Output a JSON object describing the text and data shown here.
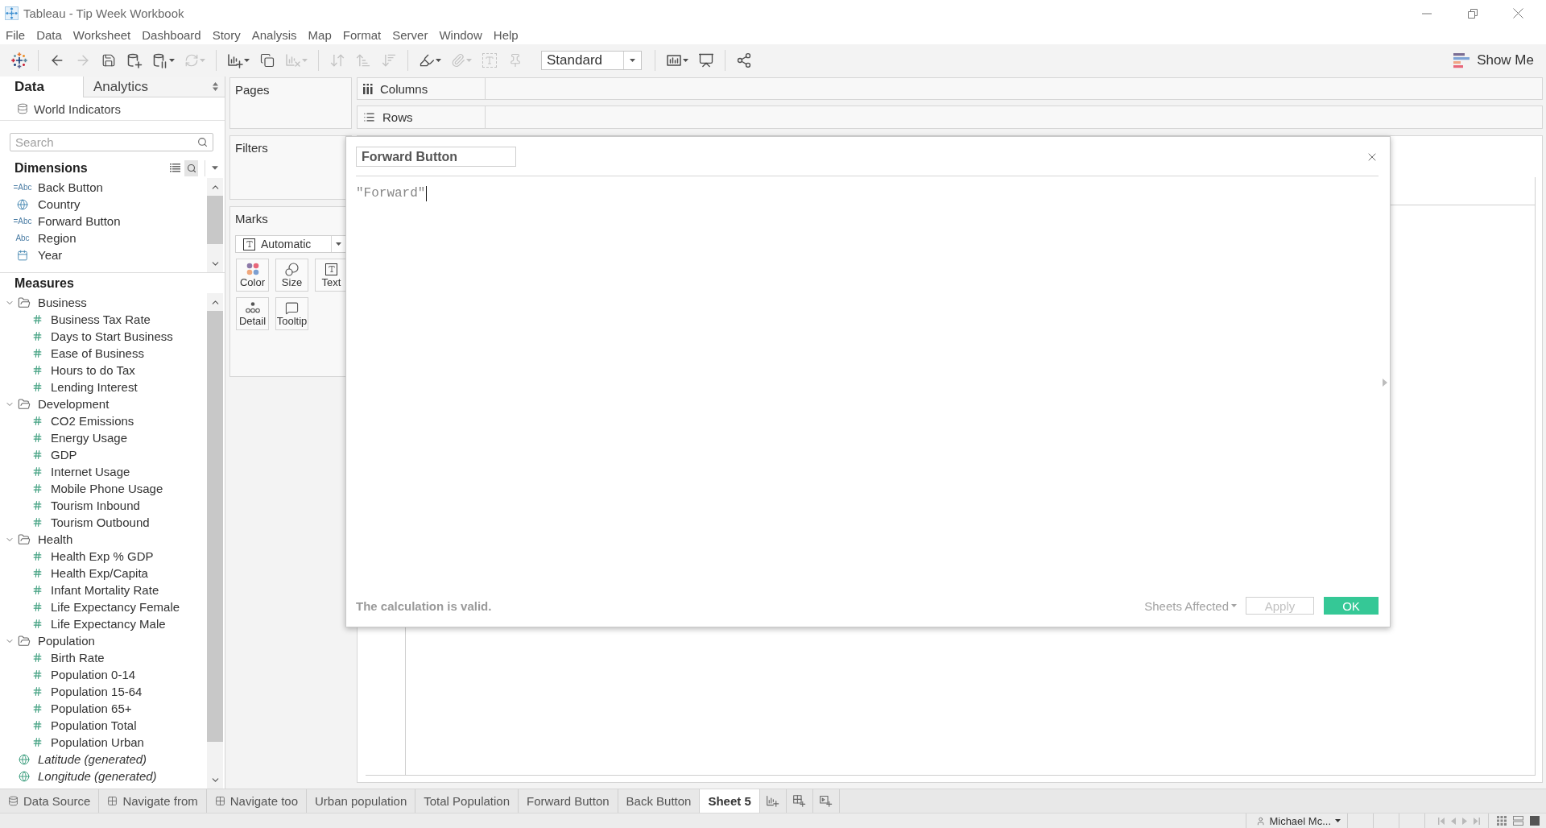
{
  "window": {
    "title": "Tableau - Tip Week Workbook"
  },
  "menu": [
    "File",
    "Data",
    "Worksheet",
    "Dashboard",
    "Story",
    "Analysis",
    "Map",
    "Format",
    "Server",
    "Window",
    "Help"
  ],
  "toolbar": {
    "groups": [
      [
        {
          "kind": "logo",
          "disabled": false,
          "menu": false
        }
      ],
      [
        {
          "kind": "back",
          "disabled": false,
          "menu": false
        },
        {
          "kind": "forward",
          "disabled": true,
          "menu": false
        },
        {
          "kind": "save",
          "disabled": false,
          "menu": false
        },
        {
          "kind": "new-data-source",
          "disabled": false,
          "menu": false
        },
        {
          "kind": "pause-updates",
          "disabled": false,
          "menu": true
        },
        {
          "kind": "refresh",
          "disabled": true,
          "menu": true
        }
      ],
      [
        {
          "kind": "new-worksheet",
          "disabled": false,
          "menu": true
        },
        {
          "kind": "duplicate",
          "disabled": false,
          "menu": false
        },
        {
          "kind": "clear",
          "disabled": true,
          "menu": true
        }
      ],
      [
        {
          "kind": "swap",
          "disabled": true,
          "menu": false
        },
        {
          "kind": "sort-ascending",
          "disabled": true,
          "menu": false
        },
        {
          "kind": "sort-descending",
          "disabled": true,
          "menu": false
        }
      ],
      [
        {
          "kind": "highlight",
          "disabled": false,
          "menu": true
        },
        {
          "kind": "annotate",
          "disabled": true,
          "menu": true
        },
        {
          "kind": "labels",
          "disabled": true,
          "menu": false
        },
        {
          "kind": "fix-axes",
          "disabled": true,
          "menu": false
        },
        {
          "kind": "fit",
          "value": "Standard",
          "disabled": false,
          "menu": true
        }
      ],
      [
        {
          "kind": "show-cards",
          "disabled": false,
          "menu": true
        },
        {
          "kind": "presentation",
          "disabled": false,
          "menu": false
        }
      ],
      [
        {
          "kind": "share",
          "disabled": false,
          "menu": false
        }
      ]
    ],
    "show_me": "Show Me"
  },
  "data_pane": {
    "tabs": [
      {
        "label": "Data",
        "selected": true
      },
      {
        "label": "Analytics",
        "selected": false
      }
    ],
    "source": "World Indicators",
    "search": {
      "placeholder": "Search"
    },
    "dimensions": {
      "title": "Dimensions",
      "items": [
        {
          "kind": "calculated",
          "type_label": "=Abc",
          "label": "Back Button"
        },
        {
          "kind": "geo",
          "label": "Country"
        },
        {
          "kind": "calculated",
          "type_label": "=Abc",
          "label": "Forward Button"
        },
        {
          "kind": "text",
          "type_label": "Abc",
          "label": "Region"
        },
        {
          "kind": "date",
          "label": "Year"
        }
      ]
    },
    "measures": {
      "title": "Measures",
      "items": [
        {
          "kind": "folder",
          "label": "Business",
          "expanded": true,
          "children": [
            {
              "kind": "number",
              "label": "Business Tax Rate"
            },
            {
              "kind": "number",
              "label": "Days to Start Business"
            },
            {
              "kind": "number",
              "label": "Ease of Business"
            },
            {
              "kind": "number",
              "label": "Hours to do Tax"
            },
            {
              "kind": "number",
              "label": "Lending Interest"
            }
          ]
        },
        {
          "kind": "folder",
          "label": "Development",
          "expanded": true,
          "children": [
            {
              "kind": "number",
              "label": "CO2 Emissions"
            },
            {
              "kind": "number",
              "label": "Energy Usage"
            },
            {
              "kind": "number",
              "label": "GDP"
            },
            {
              "kind": "number",
              "label": "Internet Usage"
            },
            {
              "kind": "number",
              "label": "Mobile Phone Usage"
            },
            {
              "kind": "number",
              "label": "Tourism Inbound"
            },
            {
              "kind": "number",
              "label": "Tourism Outbound"
            }
          ]
        },
        {
          "kind": "folder",
          "label": "Health",
          "expanded": true,
          "children": [
            {
              "kind": "number",
              "label": "Health Exp % GDP"
            },
            {
              "kind": "number",
              "label": "Health Exp/Capita"
            },
            {
              "kind": "number",
              "label": "Infant Mortality Rate"
            },
            {
              "kind": "number",
              "label": "Life Expectancy Female"
            },
            {
              "kind": "number",
              "label": "Life Expectancy Male"
            }
          ]
        },
        {
          "kind": "folder",
          "label": "Population",
          "expanded": true,
          "children": [
            {
              "kind": "number",
              "label": "Birth Rate"
            },
            {
              "kind": "number",
              "label": "Population 0-14"
            },
            {
              "kind": "number",
              "label": "Population 15-64"
            },
            {
              "kind": "number",
              "label": "Population 65+"
            },
            {
              "kind": "number",
              "label": "Population Total"
            },
            {
              "kind": "number",
              "label": "Population Urban"
            }
          ]
        },
        {
          "kind": "generated",
          "label": "Latitude (generated)"
        },
        {
          "kind": "generated",
          "label": "Longitude (generated)"
        }
      ]
    }
  },
  "cards": {
    "pages": {
      "title": "Pages"
    },
    "filters": {
      "title": "Filters"
    },
    "marks": {
      "title": "Marks",
      "mark_type": "Automatic",
      "buttons": [
        {
          "kind": "color",
          "label": "Color"
        },
        {
          "kind": "size",
          "label": "Size"
        },
        {
          "kind": "text",
          "label": "Text"
        },
        {
          "kind": "detail",
          "label": "Detail"
        },
        {
          "kind": "tooltip",
          "label": "Tooltip"
        }
      ]
    }
  },
  "shelves": [
    {
      "kind": "columns",
      "label": "Columns"
    },
    {
      "kind": "rows",
      "label": "Rows"
    }
  ],
  "calculation_dialog": {
    "name": "Forward Button",
    "formula": "\"Forward\"",
    "status": "The calculation is valid.",
    "sheets_affected": "Sheets Affected",
    "buttons": [
      {
        "kind": "apply",
        "label": "Apply",
        "disabled": true
      },
      {
        "kind": "ok",
        "label": "OK",
        "disabled": false
      }
    ]
  },
  "sheet_tabs": {
    "tabs": [
      {
        "kind": "data-source",
        "label": "Data Source",
        "selected": false
      },
      {
        "kind": "dashboard",
        "label": "Navigate from",
        "selected": false
      },
      {
        "kind": "dashboard",
        "label": "Navigate too",
        "selected": false
      },
      {
        "kind": "worksheet",
        "label": "Urban population",
        "selected": false
      },
      {
        "kind": "worksheet",
        "label": "Total Population",
        "selected": false
      },
      {
        "kind": "worksheet",
        "label": "Forward Button",
        "selected": false
      },
      {
        "kind": "worksheet",
        "label": "Back Button",
        "selected": false
      },
      {
        "kind": "worksheet",
        "label": "Sheet 5",
        "selected": true
      }
    ],
    "new_buttons": [
      {
        "kind": "worksheet"
      },
      {
        "kind": "dashboard"
      },
      {
        "kind": "story"
      }
    ]
  },
  "status_bar": {
    "user": "Michael Mc..."
  }
}
